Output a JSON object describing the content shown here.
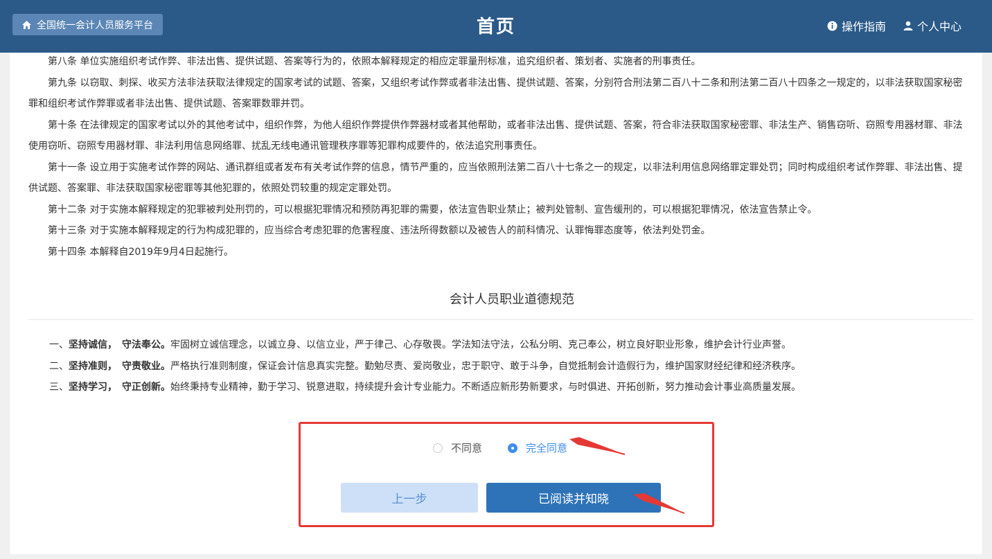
{
  "header": {
    "home_label": "全国统一会计人员服务平台",
    "title": "首页",
    "guide_label": "操作指南",
    "profile_label": "个人中心"
  },
  "law_paragraphs": [
    "第八条 单位实施组织考试作弊、非法出售、提供试题、答案等行为的，依照本解释规定的相应定罪量刑标准，追究组织者、策划者、实施者的刑事责任。",
    "第九条 以窃取、刺探、收买方法非法获取法律规定的国家考试的试题、答案，又组织考试作弊或者非法出售、提供试题、答案，分别符合刑法第二百八十二条和刑法第二百八十四条之一规定的，以非法获取国家秘密罪和组织考试作弊罪或者非法出售、提供试题、答案罪数罪并罚。",
    "第十条 在法律规定的国家考试以外的其他考试中，组织作弊，为他人组织作弊提供作弊器材或者其他帮助，或者非法出售、提供试题、答案，符合非法获取国家秘密罪、非法生产、销售窃听、窃照专用器材罪、非法使用窃听、窃照专用器材罪、非法利用信息网络罪、扰乱无线电通讯管理秩序罪等犯罪构成要件的，依法追究刑事责任。",
    "第十一条 设立用于实施考试作弊的网站、通讯群组或者发布有关考试作弊的信息，情节严重的，应当依照刑法第二百八十七条之一的规定，以非法利用信息网络罪定罪处罚；同时构成组织考试作弊罪、非法出售、提供试题、答案罪、非法获取国家秘密罪等其他犯罪的，依照处罚较重的规定定罪处罚。",
    "第十二条 对于实施本解释规定的犯罪被判处刑罚的，可以根据犯罪情况和预防再犯罪的需要，依法宣告职业禁止；被判处管制、宣告缓刑的，可以根据犯罪情况，依法宣告禁止令。",
    "第十三条 对于实施本解释规定的行为构成犯罪的，应当综合考虑犯罪的危害程度、违法所得数额以及被告人的前科情况、认罪悔罪态度等，依法判处罚金。",
    "第十四条 本解释自2019年9月4日起施行。"
  ],
  "ethics": {
    "title": "会计人员职业道德规范",
    "items": [
      {
        "prefix": "一、",
        "bold": "坚持诚信，　守法奉公。",
        "text": "牢固树立诚信理念，以诚立身、以信立业，严于律己、心存敬畏。学法知法守法，公私分明、克己奉公，树立良好职业形象，维护会计行业声誉。"
      },
      {
        "prefix": "二、",
        "bold": "坚持准则，　守责敬业。",
        "text": "严格执行准则制度，保证会计信息真实完整。勤勉尽责、爱岗敬业，忠于职守、敢于斗争，自觉抵制会计造假行为，维护国家财经纪律和经济秩序。"
      },
      {
        "prefix": "三、",
        "bold": "坚持学习，　守正创新。",
        "text": "始终秉持专业精神，勤于学习、锐意进取，持续提升会计专业能力。不断适应新形势新要求，与时俱进、开拓创新，努力推动会计事业高质量发展。"
      }
    ]
  },
  "agreement": {
    "disagree_label": "不同意",
    "agree_label": "完全同意",
    "selected": "agree"
  },
  "buttons": {
    "prev_label": "上一步",
    "confirm_label": "已阅读并知晓"
  },
  "colors": {
    "header_bg": "#2b5a89",
    "accent": "#3f8ee8",
    "primary_button": "#2e73b8",
    "annotation": "#e53935"
  }
}
